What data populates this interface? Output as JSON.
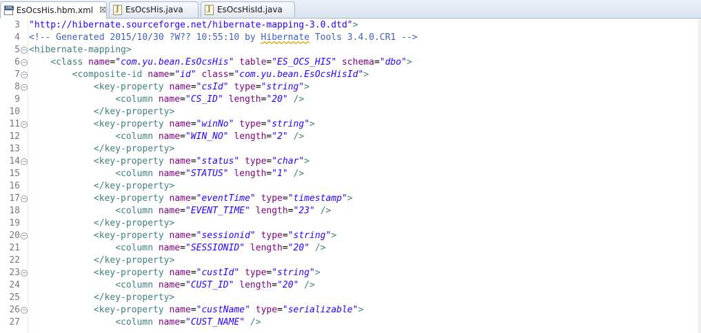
{
  "tabs": [
    {
      "label": "EsOcsHis.hbm.xml",
      "icon": "xml-file-icon",
      "active": true,
      "close": "☒"
    },
    {
      "label": "EsOcsHis.java",
      "icon": "java-file-icon",
      "active": false
    },
    {
      "label": "EsOcsHisId.java",
      "icon": "java-file-icon",
      "active": false
    }
  ],
  "editor": {
    "lines": [
      {
        "n": "3",
        "fold": false,
        "indent": "",
        "tokens": [
          [
            "s",
            "\"http://hibernate.sourceforge.net/hibernate-mapping-3.0.dtd\""
          ],
          [
            "t",
            ">"
          ]
        ]
      },
      {
        "n": "4",
        "fold": false,
        "indent": "",
        "tokens": [
          [
            "c",
            "<!-- Generated 2015/10/30 ?W?? 10:55:10 by "
          ],
          [
            "cs",
            "Hibernate"
          ],
          [
            "c",
            " Tools 3.4.0.CR1 -->"
          ]
        ]
      },
      {
        "n": "5",
        "fold": true,
        "indent": "",
        "tokens": [
          [
            "t",
            "<hibernate-mapping>"
          ]
        ]
      },
      {
        "n": "6",
        "fold": true,
        "indent": "    ",
        "tokens": [
          [
            "t",
            "<class "
          ],
          [
            "a",
            "name"
          ],
          [
            "p",
            "="
          ],
          [
            "v",
            "\"com.yu.bean.EsOcsHis\""
          ],
          [
            "p",
            " "
          ],
          [
            "a",
            "table"
          ],
          [
            "p",
            "="
          ],
          [
            "v",
            "\"ES_OCS_HIS\""
          ],
          [
            "p",
            " "
          ],
          [
            "a",
            "schema"
          ],
          [
            "p",
            "="
          ],
          [
            "v",
            "\"dbo\""
          ],
          [
            "t",
            ">"
          ]
        ]
      },
      {
        "n": "7",
        "fold": true,
        "indent": "        ",
        "tokens": [
          [
            "t",
            "<composite-id "
          ],
          [
            "a",
            "name"
          ],
          [
            "p",
            "="
          ],
          [
            "v",
            "\"id\""
          ],
          [
            "p",
            " "
          ],
          [
            "a",
            "class"
          ],
          [
            "p",
            "="
          ],
          [
            "v",
            "\"com.yu.bean.EsOcsHisId\""
          ],
          [
            "t",
            ">"
          ]
        ]
      },
      {
        "n": "8",
        "fold": true,
        "indent": "            ",
        "tokens": [
          [
            "t",
            "<key-property "
          ],
          [
            "a",
            "name"
          ],
          [
            "p",
            "="
          ],
          [
            "v",
            "\"csId\""
          ],
          [
            "p",
            " "
          ],
          [
            "a",
            "type"
          ],
          [
            "p",
            "="
          ],
          [
            "v",
            "\"string\""
          ],
          [
            "t",
            ">"
          ]
        ]
      },
      {
        "n": "9",
        "fold": false,
        "indent": "                ",
        "tokens": [
          [
            "t",
            "<column "
          ],
          [
            "a",
            "name"
          ],
          [
            "p",
            "="
          ],
          [
            "v",
            "\"CS_ID\""
          ],
          [
            "p",
            " "
          ],
          [
            "a",
            "length"
          ],
          [
            "p",
            "="
          ],
          [
            "v",
            "\"20\""
          ],
          [
            "p",
            " "
          ],
          [
            "t",
            "/>"
          ]
        ]
      },
      {
        "n": "10",
        "fold": false,
        "indent": "            ",
        "tokens": [
          [
            "t",
            "</key-property>"
          ]
        ]
      },
      {
        "n": "11",
        "fold": true,
        "indent": "            ",
        "tokens": [
          [
            "t",
            "<key-property "
          ],
          [
            "a",
            "name"
          ],
          [
            "p",
            "="
          ],
          [
            "v",
            "\"winNo\""
          ],
          [
            "p",
            " "
          ],
          [
            "a",
            "type"
          ],
          [
            "p",
            "="
          ],
          [
            "v",
            "\"string\""
          ],
          [
            "t",
            ">"
          ]
        ]
      },
      {
        "n": "12",
        "fold": false,
        "indent": "                ",
        "tokens": [
          [
            "t",
            "<column "
          ],
          [
            "a",
            "name"
          ],
          [
            "p",
            "="
          ],
          [
            "v",
            "\"WIN_NO\""
          ],
          [
            "p",
            " "
          ],
          [
            "a",
            "length"
          ],
          [
            "p",
            "="
          ],
          [
            "v",
            "\"2\""
          ],
          [
            "p",
            " "
          ],
          [
            "t",
            "/>"
          ]
        ]
      },
      {
        "n": "13",
        "fold": false,
        "indent": "            ",
        "tokens": [
          [
            "t",
            "</key-property>"
          ]
        ]
      },
      {
        "n": "14",
        "fold": true,
        "indent": "            ",
        "tokens": [
          [
            "t",
            "<key-property "
          ],
          [
            "a",
            "name"
          ],
          [
            "p",
            "="
          ],
          [
            "v",
            "\"status\""
          ],
          [
            "p",
            " "
          ],
          [
            "a",
            "type"
          ],
          [
            "p",
            "="
          ],
          [
            "v",
            "\"char\""
          ],
          [
            "t",
            ">"
          ]
        ]
      },
      {
        "n": "15",
        "fold": false,
        "indent": "                ",
        "tokens": [
          [
            "t",
            "<column "
          ],
          [
            "a",
            "name"
          ],
          [
            "p",
            "="
          ],
          [
            "v",
            "\"STATUS\""
          ],
          [
            "p",
            " "
          ],
          [
            "a",
            "length"
          ],
          [
            "p",
            "="
          ],
          [
            "v",
            "\"1\""
          ],
          [
            "p",
            " "
          ],
          [
            "t",
            "/>"
          ]
        ]
      },
      {
        "n": "16",
        "fold": false,
        "indent": "            ",
        "tokens": [
          [
            "t",
            "</key-property>"
          ]
        ]
      },
      {
        "n": "17",
        "fold": true,
        "indent": "            ",
        "tokens": [
          [
            "t",
            "<key-property "
          ],
          [
            "a",
            "name"
          ],
          [
            "p",
            "="
          ],
          [
            "v",
            "\"eventTime\""
          ],
          [
            "p",
            " "
          ],
          [
            "a",
            "type"
          ],
          [
            "p",
            "="
          ],
          [
            "v",
            "\"timestamp\""
          ],
          [
            "t",
            ">"
          ]
        ]
      },
      {
        "n": "18",
        "fold": false,
        "indent": "                ",
        "tokens": [
          [
            "t",
            "<column "
          ],
          [
            "a",
            "name"
          ],
          [
            "p",
            "="
          ],
          [
            "v",
            "\"EVENT_TIME\""
          ],
          [
            "p",
            " "
          ],
          [
            "a",
            "length"
          ],
          [
            "p",
            "="
          ],
          [
            "v",
            "\"23\""
          ],
          [
            "p",
            " "
          ],
          [
            "t",
            "/>"
          ]
        ]
      },
      {
        "n": "19",
        "fold": false,
        "indent": "            ",
        "tokens": [
          [
            "t",
            "</key-property>"
          ]
        ]
      },
      {
        "n": "20",
        "fold": true,
        "indent": "            ",
        "tokens": [
          [
            "t",
            "<key-property "
          ],
          [
            "a",
            "name"
          ],
          [
            "p",
            "="
          ],
          [
            "v",
            "\"sessionid\""
          ],
          [
            "p",
            " "
          ],
          [
            "a",
            "type"
          ],
          [
            "p",
            "="
          ],
          [
            "v",
            "\"string\""
          ],
          [
            "t",
            ">"
          ]
        ]
      },
      {
        "n": "21",
        "fold": false,
        "indent": "                ",
        "tokens": [
          [
            "t",
            "<column "
          ],
          [
            "a",
            "name"
          ],
          [
            "p",
            "="
          ],
          [
            "v",
            "\"SESSIONID\""
          ],
          [
            "p",
            " "
          ],
          [
            "a",
            "length"
          ],
          [
            "p",
            "="
          ],
          [
            "v",
            "\"20\""
          ],
          [
            "p",
            " "
          ],
          [
            "t",
            "/>"
          ]
        ]
      },
      {
        "n": "22",
        "fold": false,
        "indent": "            ",
        "tokens": [
          [
            "t",
            "</key-property>"
          ]
        ]
      },
      {
        "n": "23",
        "fold": true,
        "indent": "            ",
        "tokens": [
          [
            "t",
            "<key-property "
          ],
          [
            "a",
            "name"
          ],
          [
            "p",
            "="
          ],
          [
            "v",
            "\"custId\""
          ],
          [
            "p",
            " "
          ],
          [
            "a",
            "type"
          ],
          [
            "p",
            "="
          ],
          [
            "v",
            "\"string\""
          ],
          [
            "t",
            ">"
          ]
        ]
      },
      {
        "n": "24",
        "fold": false,
        "indent": "                ",
        "tokens": [
          [
            "t",
            "<column "
          ],
          [
            "a",
            "name"
          ],
          [
            "p",
            "="
          ],
          [
            "v",
            "\"CUST_ID\""
          ],
          [
            "p",
            " "
          ],
          [
            "a",
            "length"
          ],
          [
            "p",
            "="
          ],
          [
            "v",
            "\"20\""
          ],
          [
            "p",
            " "
          ],
          [
            "t",
            "/>"
          ]
        ]
      },
      {
        "n": "25",
        "fold": false,
        "indent": "            ",
        "tokens": [
          [
            "t",
            "</key-property>"
          ]
        ]
      },
      {
        "n": "26",
        "fold": true,
        "indent": "            ",
        "tokens": [
          [
            "t",
            "<key-property "
          ],
          [
            "a",
            "name"
          ],
          [
            "p",
            "="
          ],
          [
            "v",
            "\"custName\""
          ],
          [
            "p",
            " "
          ],
          [
            "a",
            "type"
          ],
          [
            "p",
            "="
          ],
          [
            "v",
            "\"serializable\""
          ],
          [
            "t",
            ">"
          ]
        ]
      },
      {
        "n": "27",
        "fold": false,
        "indent": "                ",
        "tokens": [
          [
            "t",
            "<column "
          ],
          [
            "a",
            "name"
          ],
          [
            "p",
            "="
          ],
          [
            "v",
            "\"CUST_NAME\""
          ],
          [
            "p",
            " "
          ],
          [
            "t",
            "/>"
          ]
        ]
      }
    ]
  },
  "colors": {
    "tag": "#3f7f7f",
    "attribute": "#7f007f",
    "value": "#2a00ff",
    "comment": "#3f5fbf",
    "line_number": "#787878"
  }
}
